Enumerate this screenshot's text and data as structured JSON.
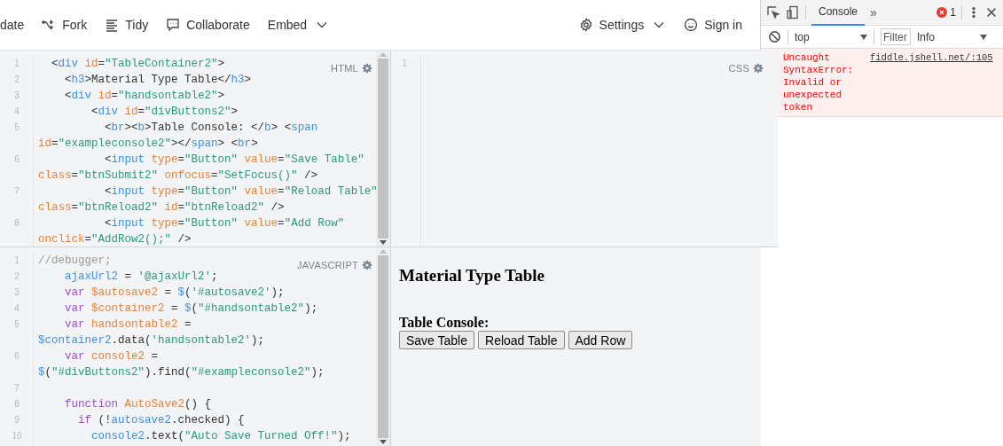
{
  "toolbar": {
    "left": [
      {
        "kind": "plain",
        "label": "date"
      },
      {
        "kind": "fork",
        "label": "Fork"
      },
      {
        "kind": "tidy",
        "label": "Tidy"
      },
      {
        "kind": "collaborate",
        "label": "Collaborate"
      },
      {
        "kind": "dropdown",
        "label": "Embed"
      }
    ],
    "right": [
      {
        "kind": "settings",
        "label": "Settings"
      },
      {
        "kind": "signin",
        "label": "Sign in"
      }
    ]
  },
  "editors": {
    "html": {
      "label": "HTML",
      "lines": [
        {
          "number": "1",
          "tokens": [
            {
              "kind": "plain",
              "text": "  <"
            },
            {
              "kind": "tag",
              "text": "div "
            },
            {
              "kind": "attr",
              "text": "id"
            },
            {
              "kind": "plain",
              "text": "="
            },
            {
              "kind": "string",
              "text": "\"TableContainer2\""
            },
            {
              "kind": "plain",
              "text": ">"
            }
          ]
        },
        {
          "number": "2",
          "tokens": [
            {
              "kind": "plain",
              "text": "    <"
            },
            {
              "kind": "tag",
              "text": "h3"
            },
            {
              "kind": "plain",
              "text": ">Material Type Table</"
            },
            {
              "kind": "tag",
              "text": "h3"
            },
            {
              "kind": "plain",
              "text": ">"
            }
          ]
        },
        {
          "number": "3",
          "tokens": [
            {
              "kind": "plain",
              "text": "    <"
            },
            {
              "kind": "tag",
              "text": "div "
            },
            {
              "kind": "attr",
              "text": "id"
            },
            {
              "kind": "plain",
              "text": "="
            },
            {
              "kind": "string",
              "text": "\"handsontable2\""
            },
            {
              "kind": "plain",
              "text": ">"
            }
          ]
        },
        {
          "number": "4",
          "tokens": [
            {
              "kind": "plain",
              "text": "        <"
            },
            {
              "kind": "tag",
              "text": "div "
            },
            {
              "kind": "attr",
              "text": "id"
            },
            {
              "kind": "plain",
              "text": "="
            },
            {
              "kind": "string",
              "text": "\"divButtons2\""
            },
            {
              "kind": "plain",
              "text": ">"
            }
          ]
        },
        {
          "number": "5",
          "tokens": [
            {
              "kind": "plain",
              "text": "          <"
            },
            {
              "kind": "tag",
              "text": "br"
            },
            {
              "kind": "plain",
              "text": "><"
            },
            {
              "kind": "tag",
              "text": "b"
            },
            {
              "kind": "plain",
              "text": ">Table Console: </"
            },
            {
              "kind": "tag",
              "text": "b"
            },
            {
              "kind": "plain",
              "text": "> <"
            },
            {
              "kind": "tag",
              "text": "span "
            },
            {
              "kind": "attr",
              "text": "id"
            },
            {
              "kind": "plain",
              "text": "="
            },
            {
              "kind": "string",
              "text": "\"exampleconsole2\""
            },
            {
              "kind": "plain",
              "text": "></"
            },
            {
              "kind": "tag",
              "text": "span"
            },
            {
              "kind": "plain",
              "text": "> <"
            },
            {
              "kind": "tag",
              "text": "br"
            },
            {
              "kind": "plain",
              "text": ">"
            }
          ]
        },
        {
          "number": "6",
          "tokens": [
            {
              "kind": "plain",
              "text": "          <"
            },
            {
              "kind": "tag",
              "text": "input "
            },
            {
              "kind": "attr",
              "text": "type"
            },
            {
              "kind": "plain",
              "text": "="
            },
            {
              "kind": "string",
              "text": "\"Button\" "
            },
            {
              "kind": "attr",
              "text": "value"
            },
            {
              "kind": "plain",
              "text": "="
            },
            {
              "kind": "string",
              "text": "\"Save Table\" "
            },
            {
              "kind": "attr",
              "text": "class"
            },
            {
              "kind": "plain",
              "text": "="
            },
            {
              "kind": "string",
              "text": "\"btnSubmit2\" "
            },
            {
              "kind": "attr",
              "text": "onfocus"
            },
            {
              "kind": "plain",
              "text": "="
            },
            {
              "kind": "string",
              "text": "\"SetFocus()\""
            },
            {
              "kind": "plain",
              "text": " />"
            }
          ]
        },
        {
          "number": "7",
          "tokens": [
            {
              "kind": "plain",
              "text": "          <"
            },
            {
              "kind": "tag",
              "text": "input "
            },
            {
              "kind": "attr",
              "text": "type"
            },
            {
              "kind": "plain",
              "text": "="
            },
            {
              "kind": "string",
              "text": "\"Button\" "
            },
            {
              "kind": "attr",
              "text": "value"
            },
            {
              "kind": "plain",
              "text": "="
            },
            {
              "kind": "string",
              "text": "\"Reload Table\" "
            },
            {
              "kind": "attr",
              "text": "class"
            },
            {
              "kind": "plain",
              "text": "="
            },
            {
              "kind": "string",
              "text": "\"btnReload2\" "
            },
            {
              "kind": "attr",
              "text": "id"
            },
            {
              "kind": "plain",
              "text": "="
            },
            {
              "kind": "string",
              "text": "\"btnReload2\""
            },
            {
              "kind": "plain",
              "text": " />"
            }
          ]
        },
        {
          "number": "8",
          "tokens": [
            {
              "kind": "plain",
              "text": "          <"
            },
            {
              "kind": "tag",
              "text": "input "
            },
            {
              "kind": "attr",
              "text": "type"
            },
            {
              "kind": "plain",
              "text": "="
            },
            {
              "kind": "string",
              "text": "\"Button\" "
            },
            {
              "kind": "attr",
              "text": "value"
            },
            {
              "kind": "plain",
              "text": "="
            },
            {
              "kind": "string",
              "text": "\"Add Row\" "
            },
            {
              "kind": "attr",
              "text": "onclick"
            },
            {
              "kind": "plain",
              "text": "="
            },
            {
              "kind": "string",
              "text": "\"AddRow2();\""
            },
            {
              "kind": "plain",
              "text": " />"
            }
          ]
        }
      ]
    },
    "css": {
      "label": "CSS",
      "lines": [
        {
          "number": "1"
        }
      ]
    },
    "javascript": {
      "label": "JAVASCRIPT",
      "lines": [
        {
          "number": "1",
          "tokens": [
            {
              "kind": "comment",
              "text": "//debugger;"
            }
          ]
        },
        {
          "number": "2",
          "tokens": [
            {
              "kind": "var",
              "text": "    ajaxUrl2"
            },
            {
              "kind": "plain",
              "text": " = "
            },
            {
              "kind": "string",
              "text": "'@ajaxUrl2'"
            },
            {
              "kind": "plain",
              "text": ";"
            }
          ]
        },
        {
          "number": "3",
          "tokens": [
            {
              "kind": "keyword",
              "text": "    var "
            },
            {
              "kind": "def",
              "text": "$autosave2"
            },
            {
              "kind": "plain",
              "text": " = "
            },
            {
              "kind": "var",
              "text": "$"
            },
            {
              "kind": "plain",
              "text": "("
            },
            {
              "kind": "string",
              "text": "'#autosave2'"
            },
            {
              "kind": "plain",
              "text": ");"
            }
          ]
        },
        {
          "number": "4",
          "tokens": [
            {
              "kind": "keyword",
              "text": "    var "
            },
            {
              "kind": "def",
              "text": "$container2"
            },
            {
              "kind": "plain",
              "text": " = "
            },
            {
              "kind": "var",
              "text": "$"
            },
            {
              "kind": "plain",
              "text": "("
            },
            {
              "kind": "string",
              "text": "\"#handsontable2\""
            },
            {
              "kind": "plain",
              "text": ");"
            }
          ]
        },
        {
          "number": "5",
          "tokens": [
            {
              "kind": "keyword",
              "text": "    var "
            },
            {
              "kind": "def",
              "text": "handsontable2"
            },
            {
              "kind": "plain",
              "text": " = "
            },
            {
              "kind": "var",
              "text": "$container2"
            },
            {
              "kind": "plain",
              "text": ".data("
            },
            {
              "kind": "string",
              "text": "'handsontable2'"
            },
            {
              "kind": "plain",
              "text": ");"
            }
          ]
        },
        {
          "number": "6",
          "tokens": [
            {
              "kind": "keyword",
              "text": "    var "
            },
            {
              "kind": "def",
              "text": "console2"
            },
            {
              "kind": "plain",
              "text": " = "
            },
            {
              "kind": "var",
              "text": "$"
            },
            {
              "kind": "plain",
              "text": "("
            },
            {
              "kind": "string",
              "text": "\"#divButtons2\""
            },
            {
              "kind": "plain",
              "text": ").find("
            },
            {
              "kind": "string",
              "text": "\"#exampleconsole2\""
            },
            {
              "kind": "plain",
              "text": ");"
            }
          ]
        },
        {
          "number": "7"
        },
        {
          "number": "8",
          "tokens": [
            {
              "kind": "keyword",
              "text": "    function "
            },
            {
              "kind": "def",
              "text": "AutoSave2"
            },
            {
              "kind": "plain",
              "text": "() {"
            }
          ]
        },
        {
          "number": "9",
          "tokens": [
            {
              "kind": "keyword",
              "text": "      if"
            },
            {
              "kind": "plain",
              "text": " (!"
            },
            {
              "kind": "var",
              "text": "autosave2"
            },
            {
              "kind": "plain",
              "text": ".checked) {"
            }
          ]
        },
        {
          "number": "10",
          "tokens": [
            {
              "kind": "var",
              "text": "        console2"
            },
            {
              "kind": "plain",
              "text": ".text("
            },
            {
              "kind": "string",
              "text": "\"Auto Save Turned Off!\""
            },
            {
              "kind": "plain",
              "text": ");"
            }
          ]
        }
      ]
    }
  },
  "result": {
    "heading": "Material Type Table",
    "console_label": "Table Console:",
    "buttons": [
      "Save Table",
      "Reload Table",
      "Add Row"
    ]
  },
  "devtools": {
    "tabs": [
      {
        "label": "Console",
        "selected": true
      }
    ],
    "more": "»",
    "error_count": "1",
    "context": "top",
    "filter_placeholder": "Filter",
    "level": "Info",
    "messages": [
      {
        "kind": "error",
        "text": "Uncaught SyntaxError: Invalid or unexpected token",
        "source": "fiddle.jshell.net/:105"
      }
    ]
  }
}
